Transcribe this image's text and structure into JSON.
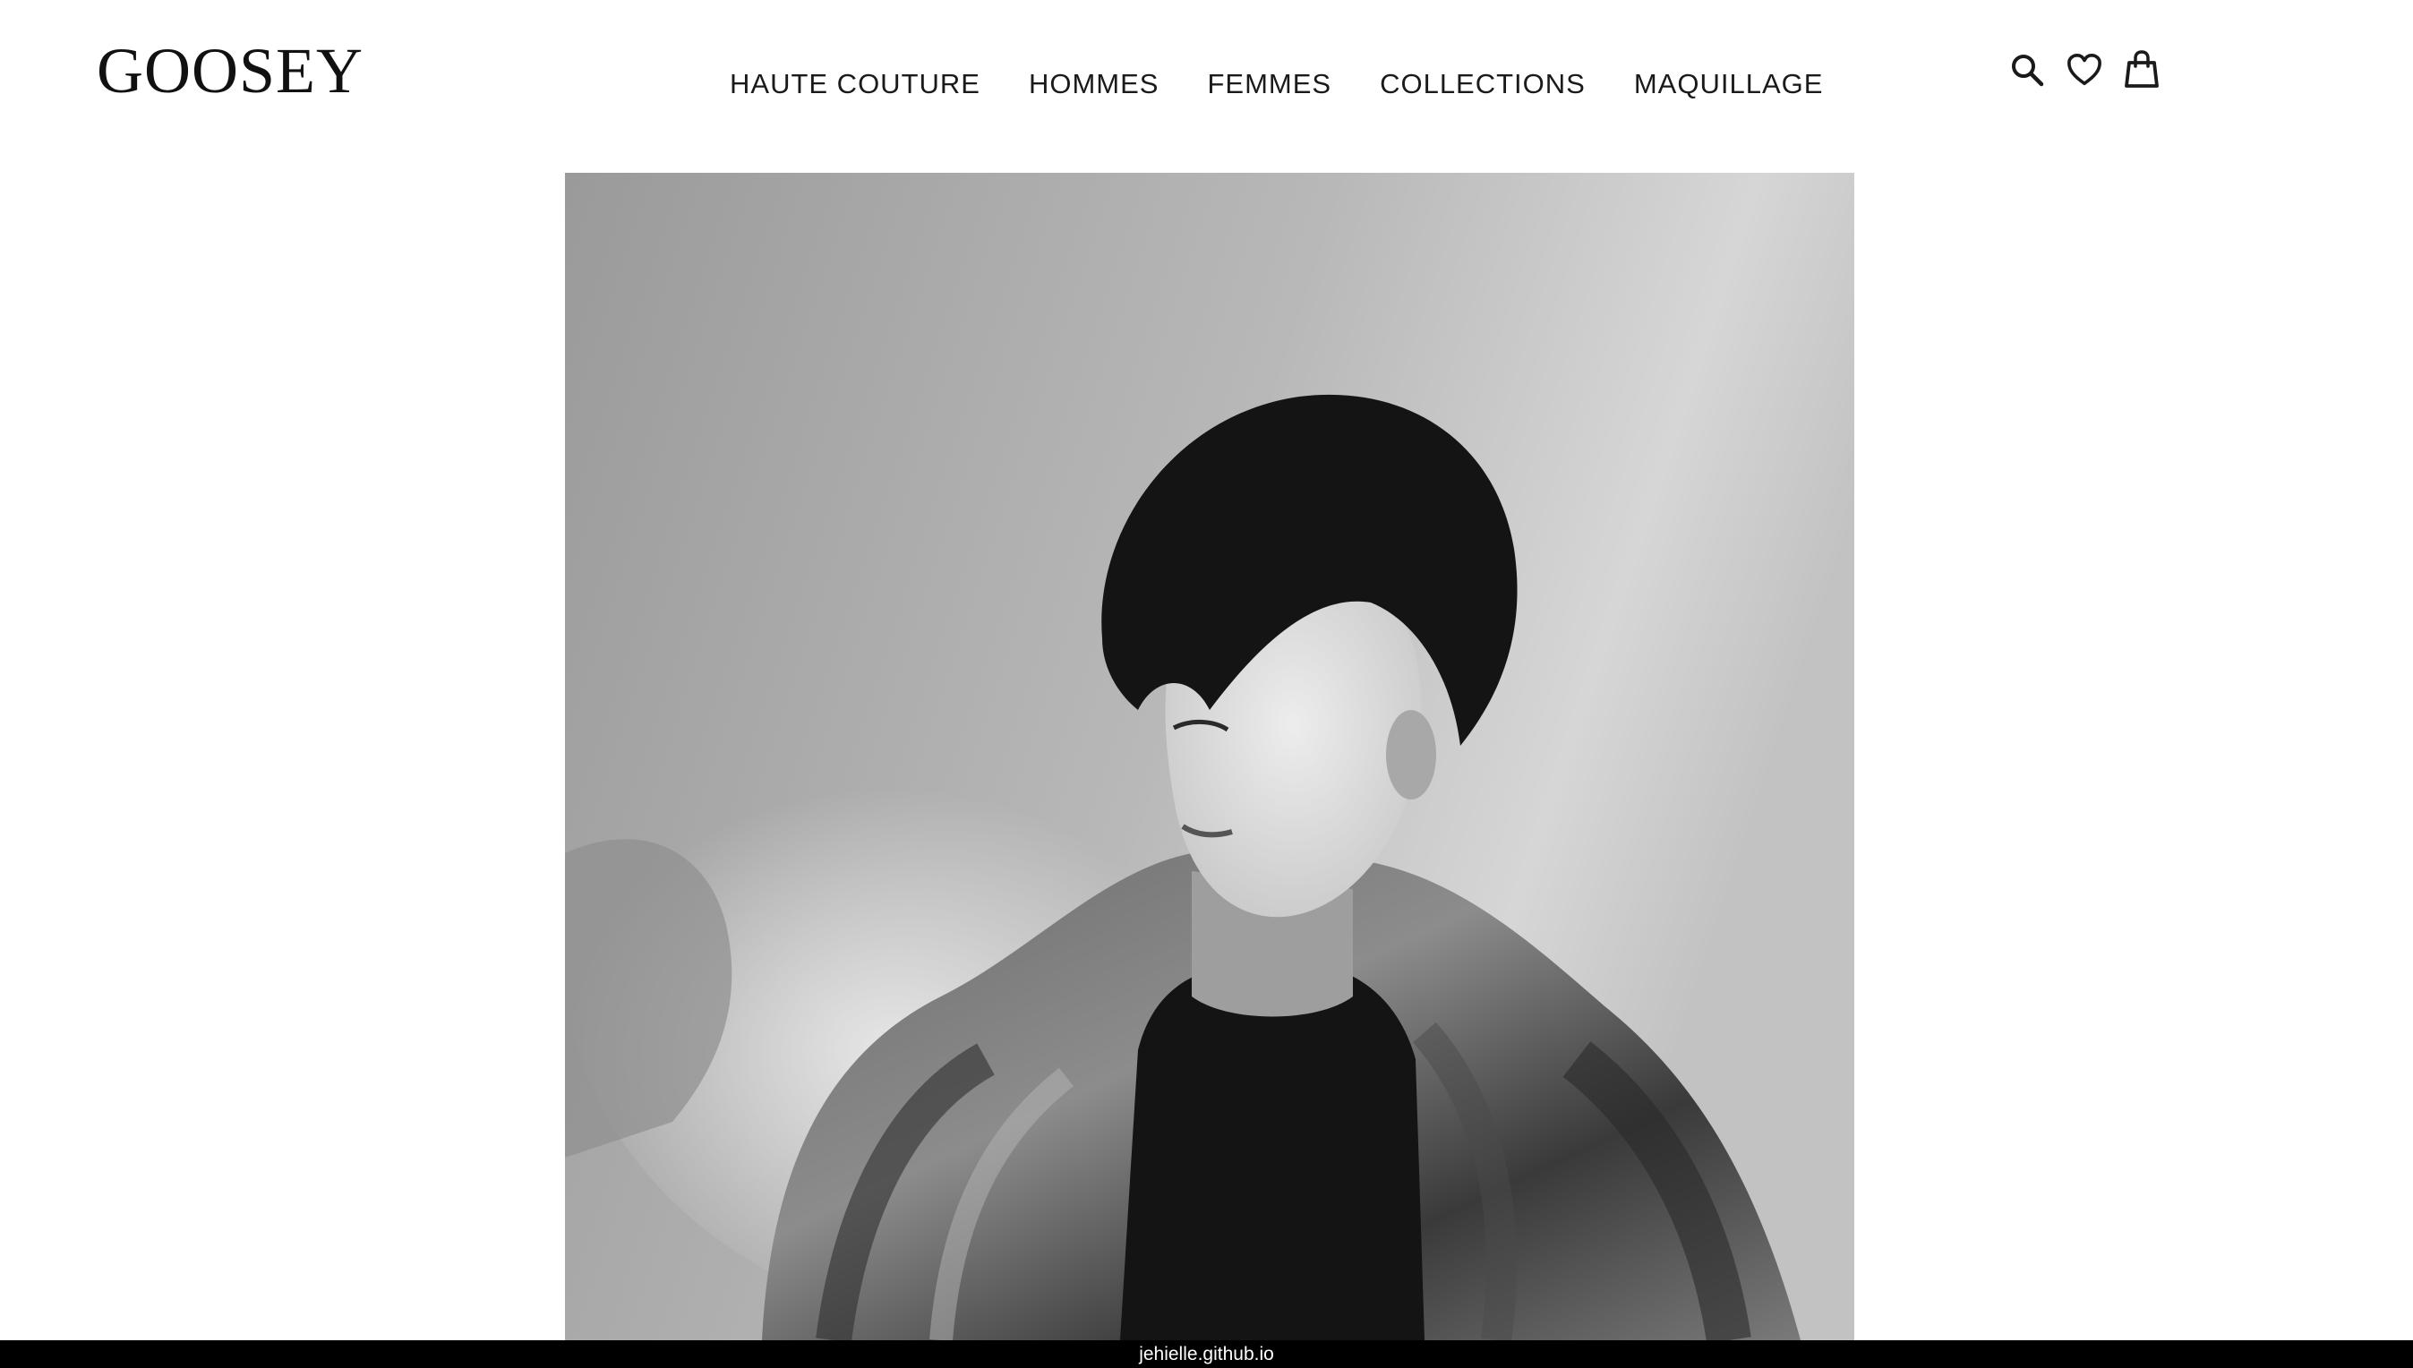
{
  "header": {
    "logo": "GOOSEY",
    "nav": [
      {
        "label": "HAUTE COUTURE"
      },
      {
        "label": "HOMMES"
      },
      {
        "label": "FEMMES"
      },
      {
        "label": "COLLECTIONS"
      },
      {
        "label": "MAQUILLAGE"
      }
    ],
    "icons": [
      "search-icon",
      "heart-icon",
      "shopping-bag-icon"
    ]
  },
  "hero": {
    "image": "black-and-white portrait photo"
  },
  "status_bar": {
    "url": "jehielle.github.io"
  }
}
